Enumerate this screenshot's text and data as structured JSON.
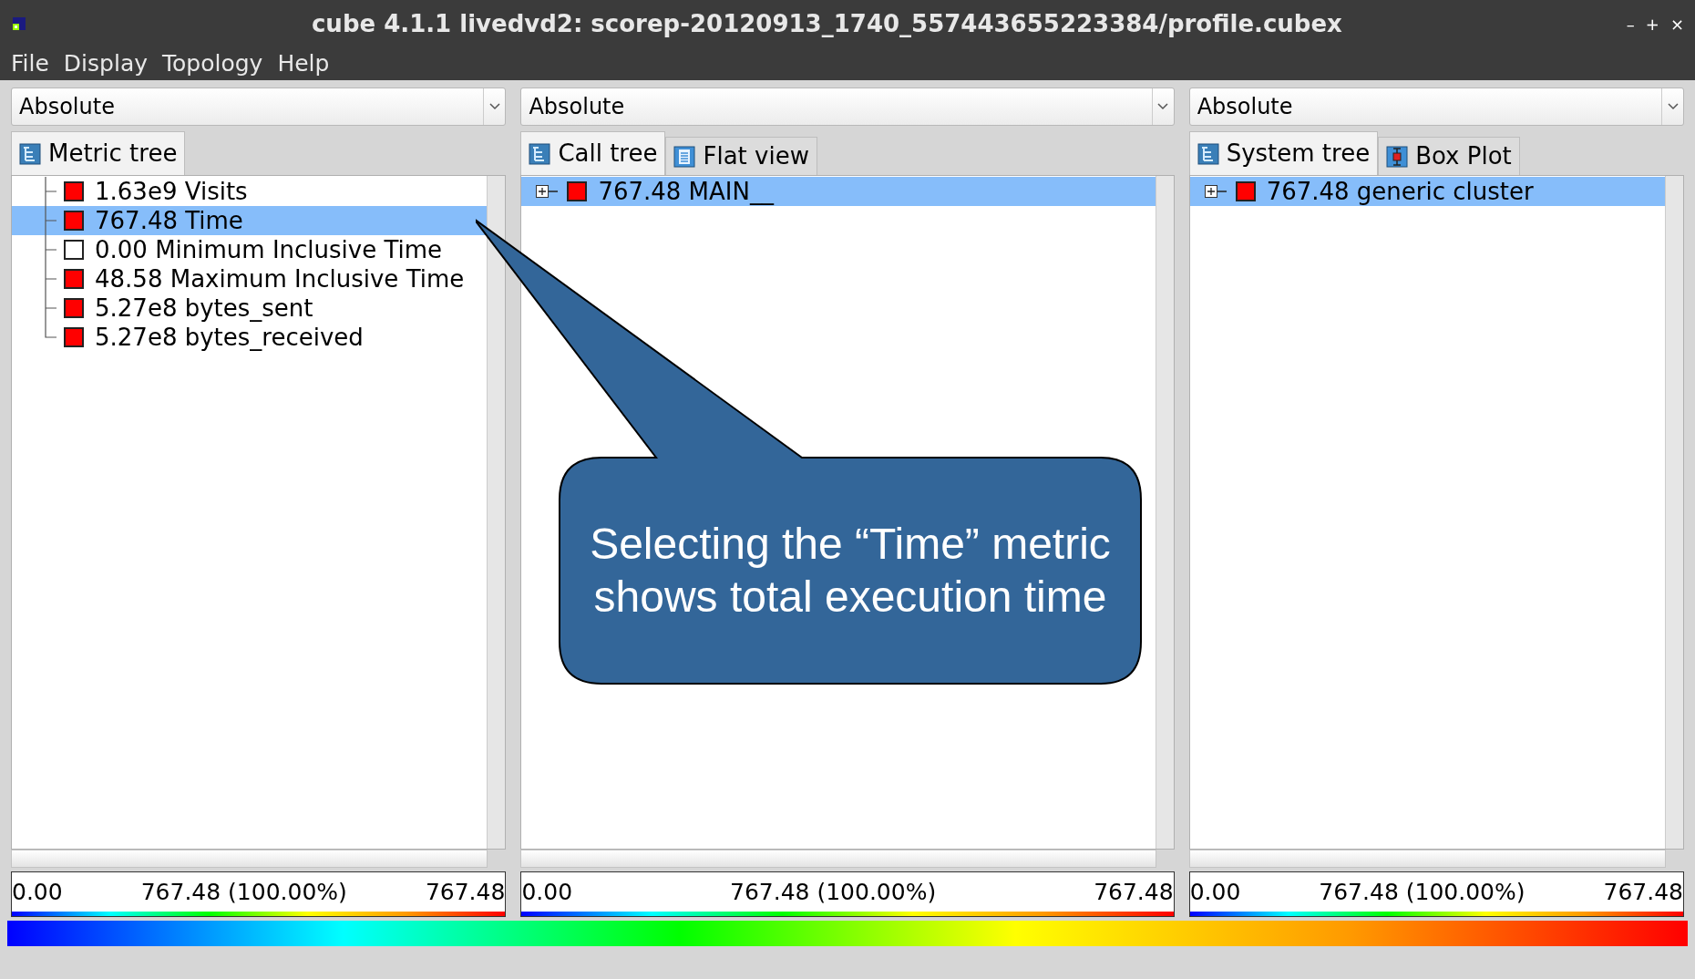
{
  "window": {
    "title": "cube 4.1.1 livedvd2: scorep-20120913_1740_557443655223384/profile.cubex",
    "controls": [
      "–",
      "+",
      "×"
    ]
  },
  "menu": [
    "File",
    "Display",
    "Topology",
    "Help"
  ],
  "panels": [
    {
      "mode": "Absolute",
      "tabs": [
        {
          "label": "Metric tree",
          "selected": true
        }
      ],
      "rows": [
        {
          "text": "1.63e9 Visits",
          "color": "#ff0000",
          "selected": false,
          "expandable": false
        },
        {
          "text": "767.48 Time",
          "color": "#ff0000",
          "selected": true,
          "expandable": false
        },
        {
          "text": "0.00 Minimum Inclusive Time",
          "color": "#ffffff",
          "selected": false,
          "expandable": false
        },
        {
          "text": "48.58 Maximum Inclusive Time",
          "color": "#ff0000",
          "selected": false,
          "expandable": false
        },
        {
          "text": "5.27e8 bytes_sent",
          "color": "#ff0000",
          "selected": false,
          "expandable": false
        },
        {
          "text": "5.27e8 bytes_received",
          "color": "#ff0000",
          "selected": false,
          "expandable": false
        }
      ],
      "scale": {
        "min": "0.00",
        "mid": "767.48 (100.00%)",
        "max": "767.48"
      }
    },
    {
      "mode": "Absolute",
      "tabs": [
        {
          "label": "Call tree",
          "selected": true
        },
        {
          "label": "Flat view",
          "selected": false
        }
      ],
      "rows": [
        {
          "text": "767.48 MAIN__",
          "color": "#ff0000",
          "selected": true,
          "expandable": true
        }
      ],
      "scale": {
        "min": "0.00",
        "mid": "767.48 (100.00%)",
        "max": "767.48"
      }
    },
    {
      "mode": "Absolute",
      "tabs": [
        {
          "label": "System tree",
          "selected": true
        },
        {
          "label": "Box Plot",
          "selected": false
        }
      ],
      "rows": [
        {
          "text": "767.48 generic cluster",
          "color": "#ff0000",
          "selected": true,
          "expandable": true
        }
      ],
      "scale": {
        "min": "0.00",
        "mid": "767.48 (100.00%)",
        "max": "767.48"
      }
    }
  ],
  "callout": {
    "lines": [
      "Selecting the “Time” metric",
      "shows total execution time"
    ]
  }
}
